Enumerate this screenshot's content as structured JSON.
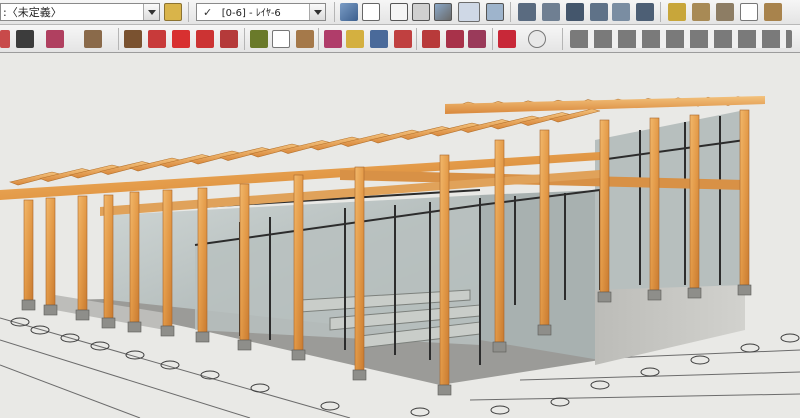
{
  "toolbar": {
    "entities_combo": ":〈未定義〉",
    "layers_combo": {
      "check": "✓",
      "value": "[0-6]  - ﾚｲﾔ-6"
    }
  },
  "icons": {
    "row1": [
      "component-icon",
      "layer-visible-icon",
      "xray-icon",
      "wireframe-icon",
      "hidden-line-icon",
      "shaded-icon",
      "textured-icon",
      "monochrome-icon",
      "iso-view-icon",
      "top-view-icon",
      "front-view-icon",
      "right-view-icon",
      "back-view-icon",
      "left-view-icon",
      "paint-icon",
      "tape-measure-icon",
      "dimension-icon",
      "text-icon",
      "axes-icon"
    ],
    "row2": [
      "eraser-icon",
      "pencil-icon",
      "arc-icon",
      "rectangle-icon",
      "push-pull-icon",
      "follow-me-icon",
      "move-icon",
      "rotate-icon",
      "scale-icon",
      "tape-icon",
      "text-label-icon",
      "orbit-icon",
      "hand-icon",
      "zoom-icon",
      "zoom-extents-icon",
      "walk-icon",
      "position-camera-icon",
      "look-around-icon",
      "section-plane-icon",
      "profile-icon",
      "section-cuts-icon"
    ]
  },
  "colors": {
    "wood": "#e8a451",
    "glass": "#bfc7c6",
    "concrete": "#c6c6c2",
    "frame": "#2c2c2c",
    "sky": "#e9e9e6"
  }
}
